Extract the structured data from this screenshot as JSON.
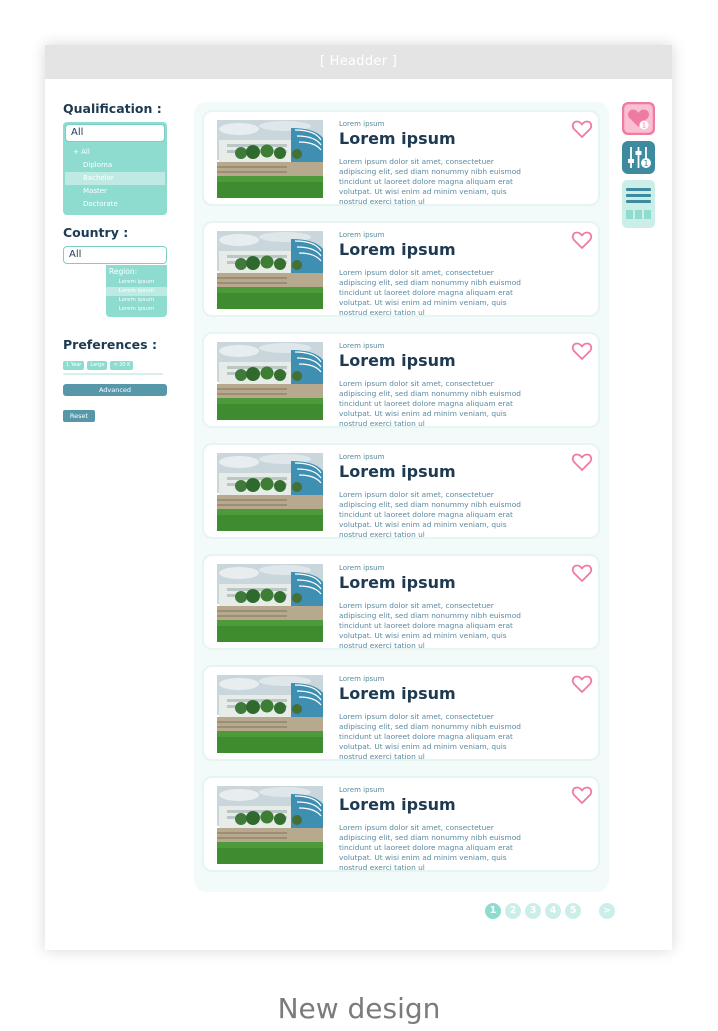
{
  "header": {
    "title": "[ Headder ]"
  },
  "sidebar": {
    "qualification": {
      "title": "Qualification :",
      "selected": "All",
      "options": [
        {
          "label": "+ All",
          "selected": false
        },
        {
          "label": "Diploma",
          "selected": false
        },
        {
          "label": "Bachelor",
          "selected": true
        },
        {
          "label": "Master",
          "selected": false
        },
        {
          "label": "Doctorate",
          "selected": false
        }
      ]
    },
    "country": {
      "title": "Country :",
      "selected": "All",
      "region_title": "Region:",
      "region_items": [
        "Lorem ipsum",
        "Lorem ipsum",
        "Lorem ipsum",
        "Lorem ipsum"
      ]
    },
    "preferences": {
      "title": "Preferences :",
      "chips": [
        "1 Year",
        "Large",
        "< 20 K"
      ],
      "advanced_label": "Advanced"
    },
    "reset_label": "Reset"
  },
  "cards": [
    {
      "kicker": "Lorem ipsum",
      "title": "Lorem ipsum",
      "body": "Lorem ipsum dolor sit amet, consectetuer adipiscing elit, sed diam nonummy nibh euismod tincidunt ut laoreet dolore magna aliquam erat volutpat. Ut wisi enim ad minim veniam, quis nostrud exerci tation ul"
    },
    {
      "kicker": "Lorem ipsum",
      "title": "Lorem ipsum",
      "body": "Lorem ipsum dolor sit amet, consectetuer adipiscing elit, sed diam nonummy nibh euismod tincidunt ut laoreet dolore magna aliquam erat volutpat. Ut wisi enim ad minim veniam, quis nostrud exerci tation ul"
    },
    {
      "kicker": "Lorem ipsum",
      "title": "Lorem ipsum",
      "body": "Lorem ipsum dolor sit amet, consectetuer adipiscing elit, sed diam nonummy nibh euismod tincidunt ut laoreet dolore magna aliquam erat volutpat. Ut wisi enim ad minim veniam, quis nostrud exerci tation ul"
    },
    {
      "kicker": "Lorem ipsum",
      "title": "Lorem ipsum",
      "body": "Lorem ipsum dolor sit amet, consectetuer adipiscing elit, sed diam nonummy nibh euismod tincidunt ut laoreet dolore magna aliquam erat volutpat. Ut wisi enim ad minim veniam, quis nostrud exerci tation ul"
    },
    {
      "kicker": "Lorem ipsum",
      "title": "Lorem ipsum",
      "body": "Lorem ipsum dolor sit amet, consectetuer adipiscing elit, sed diam nonummy nibh euismod tincidunt ut laoreet dolore magna aliquam erat volutpat. Ut wisi enim ad minim veniam, quis nostrud exerci tation ul"
    },
    {
      "kicker": "Lorem ipsum",
      "title": "Lorem ipsum",
      "body": "Lorem ipsum dolor sit amet, consectetuer adipiscing elit, sed diam nonummy nibh euismod tincidunt ut laoreet dolore magna aliquam erat volutpat. Ut wisi enim ad minim veniam, quis nostrud exerci tation ul"
    },
    {
      "kicker": "Lorem ipsum",
      "title": "Lorem ipsum",
      "body": "Lorem ipsum dolor sit amet, consectetuer adipiscing elit, sed diam nonummy nibh euismod tincidunt ut laoreet dolore magna aliquam erat volutpat. Ut wisi enim ad minim veniam, quis nostrud exerci tation ul"
    }
  ],
  "rail": {
    "favorites_count": "1",
    "filters_count": "1",
    "icons": [
      "heart-icon",
      "filter-sliders-icon",
      "list-view-icon",
      "grid-view-icon"
    ]
  },
  "pagination": {
    "pages": [
      "1",
      "2",
      "3",
      "4",
      "5"
    ],
    "active": "1",
    "next": ">"
  },
  "caption": "New design",
  "colors": {
    "accent": "#8edbd0",
    "dark": "#1d3a52",
    "button": "#5697aa",
    "heart": "#f07ba0"
  }
}
